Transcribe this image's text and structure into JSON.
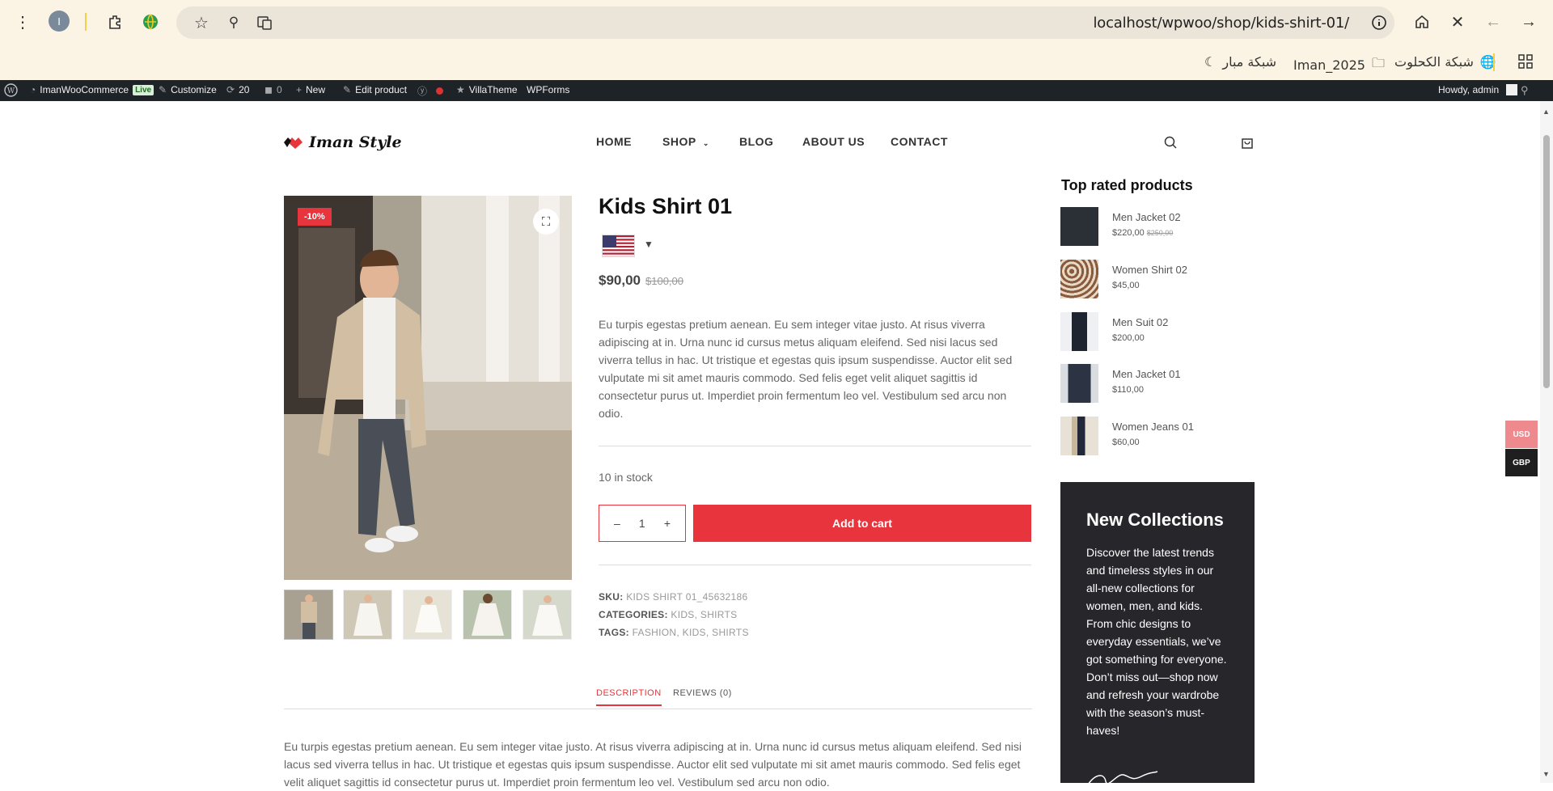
{
  "browser": {
    "url": "localhost/wpwoo/shop/kids-shirt-01/",
    "profile_initial": "I",
    "bookmarks": [
      "شبكة الكحلوت",
      "Iman_2025",
      "شبكة مبار"
    ]
  },
  "admin_bar": {
    "site_name": "ImanWooCommerce",
    "live": "Live",
    "customize": "Customize",
    "updates": "20",
    "comments": "0",
    "new": "New",
    "edit_product": "Edit product",
    "villatheme": "VillaTheme",
    "wpforms": "WPForms",
    "howdy": "Howdy, admin"
  },
  "site": {
    "logo_text": "Iman Style",
    "menu": [
      "HOME",
      "SHOP",
      "BLOG",
      "ABOUT US",
      "CONTACT"
    ]
  },
  "product": {
    "sale_badge": "-10%",
    "title": "Kids Shirt 01",
    "price_now": "$90,00",
    "price_old": "$100,00",
    "short_description": "Eu turpis egestas pretium aenean. Eu sem integer vitae justo. At risus viverra adipiscing at in. Urna nunc id cursus metus aliquam eleifend. Sed nisi lacus sed viverra tellus in hac. Ut tristique et egestas quis ipsum suspendisse. Auctor elit sed vulputate mi sit amet mauris commodo. Sed felis eget velit aliquet sagittis id consectetur purus ut. Imperdiet proin fermentum leo vel. Vestibulum sed arcu non odio.",
    "stock": "10 in stock",
    "quantity": "1",
    "add_to_cart": "Add to cart",
    "sku_label": "SKU:",
    "sku": "KIDS SHIRT 01_45632186",
    "categories_label": "CATEGORIES:",
    "categories": [
      "KIDS",
      "SHIRTS"
    ],
    "tags_label": "TAGS:",
    "tags": [
      "FASHION",
      "KIDS",
      "SHIRTS"
    ],
    "tabs": [
      "DESCRIPTION",
      "REVIEWS (0)"
    ],
    "long_description": "Eu turpis egestas pretium aenean. Eu sem integer vitae justo. At risus viverra adipiscing at in. Urna nunc id cursus metus aliquam eleifend. Sed nisi lacus sed viverra tellus in hac. Ut tristique et egestas quis ipsum suspendisse. Auctor elit sed vulputate mi sit amet mauris commodo. Sed felis eget velit aliquet sagittis id consectetur purus ut. Imperdiet proin fermentum leo vel. Vestibulum sed arcu non odio."
  },
  "sidebar": {
    "top_rated_title": "Top rated products",
    "top_rated": [
      {
        "name": "Men Jacket 02",
        "price": "$220,00",
        "old": "$250,00",
        "color": "#2b2f36"
      },
      {
        "name": "Women Shirt 02",
        "price": "$45,00",
        "old": "",
        "color": "#8a5a3c"
      },
      {
        "name": "Men Suit 02",
        "price": "$200,00",
        "old": "",
        "color": "#1e2430"
      },
      {
        "name": "Men Jacket 01",
        "price": "$110,00",
        "old": "",
        "color": "#2c3444"
      },
      {
        "name": "Women Jeans 01",
        "price": "$60,00",
        "old": "",
        "color": "#c9b79a"
      }
    ],
    "promo_title": "New Collections",
    "promo_text": "Discover the latest trends and timeless styles in our all-new collections for women, men, and kids. From chic designs to everyday essentials, we’ve got something for everyone. Don’t miss out—shop now and refresh your wardrobe with the season’s must-haves!"
  },
  "currency": [
    "USD",
    "GBP"
  ],
  "colors": {
    "accent": "#e8343c",
    "admin_bar": "#1d2327",
    "promo_bg": "#27262b"
  }
}
